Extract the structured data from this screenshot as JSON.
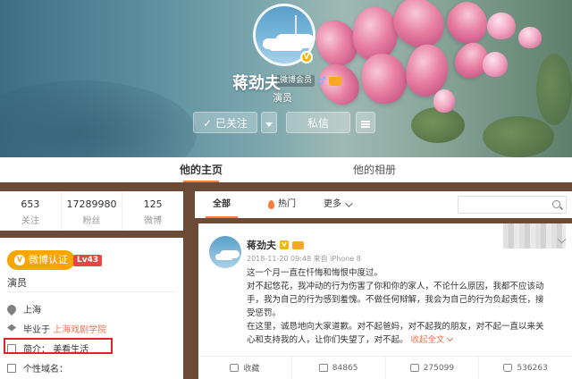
{
  "profile": {
    "name": "蒋劲夫",
    "badge_text": "微博会员",
    "description": "演员",
    "follow_label": "已关注",
    "message_label": "私信"
  },
  "tabs": [
    {
      "label": "他的主页"
    },
    {
      "label": "他的相册"
    }
  ],
  "stats": [
    {
      "value": "653",
      "label": "关注"
    },
    {
      "value": "17289980",
      "label": "粉丝"
    },
    {
      "value": "125",
      "label": "微博"
    }
  ],
  "info": {
    "verify_label": "微博认证",
    "level": "Lv43",
    "role": "演员",
    "location": "上海",
    "school_prefix": "毕业于",
    "school": "上海戏剧学院",
    "bio_label": "简介：",
    "bio_value": "美看生活",
    "domain_label": "个性域名："
  },
  "filter": {
    "all": "全部",
    "hot": "热门",
    "more": "更多"
  },
  "post": {
    "author": "蒋劲夫",
    "meta": "2018-11-20 09:48 来自 iPhone 8",
    "lines": [
      "这一个月一直在忏悔和悔恨中度过。",
      "对不起悠花，我冲动的行为伤害了你和你的家人，不论什么原因，我都不应该动",
      "手，我为自己的行为感到羞愧。不做任何辩解，我会为自己的行为负起责任，接",
      "受惩罚。",
      "在这里，诚恳地向大家道歉。对不起爸妈，对不起我的朋友，对不起一直以来关",
      "心和支持我的人，让你们失望了，对不起。"
    ],
    "expand": "收起全文"
  },
  "actions": [
    {
      "label": "收藏"
    },
    {
      "label": "84865"
    },
    {
      "label": "275099"
    },
    {
      "label": "536263"
    }
  ],
  "colors": {
    "accent": "#fa7d3c",
    "verify": "#f7a600",
    "link": "#eb7350",
    "highlight": "#d9262b"
  }
}
